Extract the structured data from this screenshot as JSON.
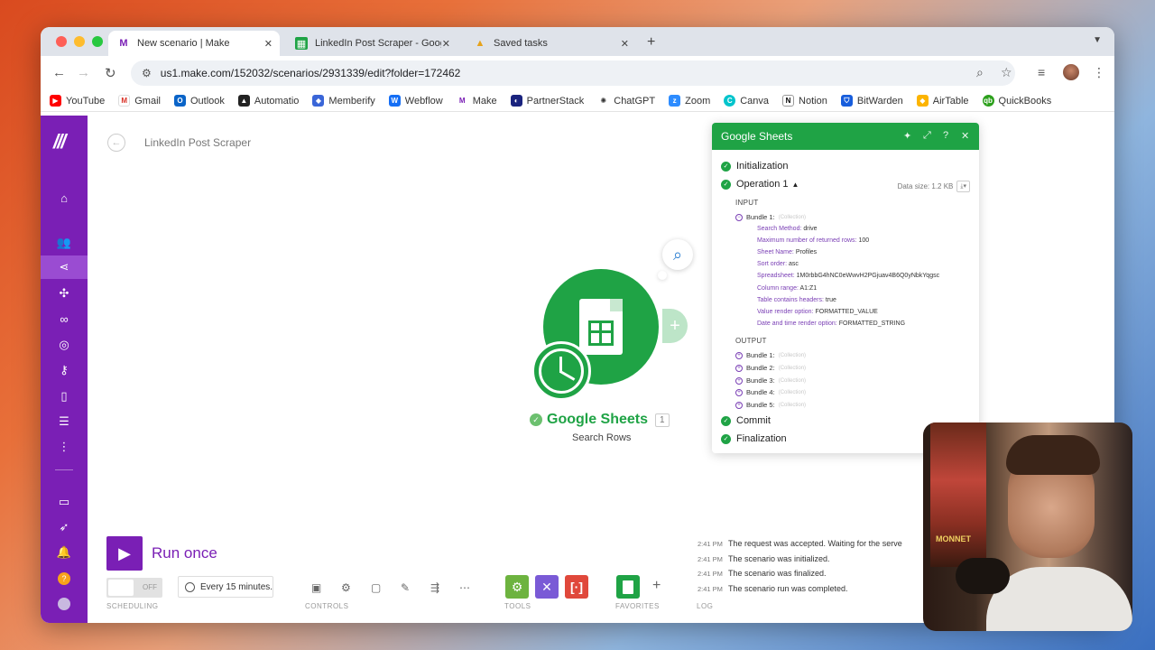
{
  "browser": {
    "tabs": [
      {
        "label": "New scenario | Make",
        "active": true
      },
      {
        "label": "LinkedIn Post Scraper - Goog",
        "active": false
      },
      {
        "label": "Saved tasks",
        "active": false
      }
    ],
    "url": "us1.make.com/152032/scenarios/2931339/edit?folder=172462",
    "bookmarks": [
      "YouTube",
      "Gmail",
      "Outlook",
      "Automatio",
      "Memberify",
      "Webflow",
      "Make",
      "PartnerStack",
      "ChatGPT",
      "Zoom",
      "Canva",
      "Notion",
      "BitWarden",
      "AirTable",
      "QuickBooks"
    ]
  },
  "scenario": {
    "name": "LinkedIn Post Scraper"
  },
  "module": {
    "title": "Google Sheets",
    "badge": "1",
    "subtitle": "Search Rows"
  },
  "panel": {
    "title": "Google Sheets",
    "initialization": "Initialization",
    "operation": "Operation 1",
    "data_size": "Data size: 1.2 KB",
    "input_label": "INPUT",
    "output_label": "OUTPUT",
    "collection_note": "(Collection)",
    "input_bundle": "Bundle 1:",
    "input_fields": [
      {
        "key": "Search Method:",
        "value": "drive"
      },
      {
        "key": "Maximum number of returned rows:",
        "value": "100"
      },
      {
        "key": "Sheet Name:",
        "value": "Profiles"
      },
      {
        "key": "Sort order:",
        "value": "asc"
      },
      {
        "key": "Spreadsheet:",
        "value": "1M0rbbG4hNC0eWwvH2PGjuav4B6Q0yNbkYqgsc"
      },
      {
        "key": "Column range:",
        "value": "A1:Z1"
      },
      {
        "key": "Table contains headers:",
        "value": "true"
      },
      {
        "key": "Value render option:",
        "value": "FORMATTED_VALUE"
      },
      {
        "key": "Date and time render option:",
        "value": "FORMATTED_STRING"
      }
    ],
    "output_bundles": [
      "Bundle 1:",
      "Bundle 2:",
      "Bundle 3:",
      "Bundle 4:",
      "Bundle 5:"
    ],
    "commit": "Commit",
    "finalization": "Finalization"
  },
  "controls": {
    "run_label": "Run once",
    "toggle_label": "OFF",
    "schedule": "Every 15 minutes.",
    "labels": {
      "scheduling": "SCHEDULING",
      "controls": "CONTROLS",
      "tools": "TOOLS",
      "favorites": "FAVORITES",
      "log": "LOG"
    }
  },
  "log": [
    {
      "time": "2:41 PM",
      "text": "The request was accepted. Waiting for the serve"
    },
    {
      "time": "2:41 PM",
      "text": "The scenario was initialized."
    },
    {
      "time": "2:41 PM",
      "text": "The scenario was finalized."
    },
    {
      "time": "2:41 PM",
      "text": "The scenario run was completed."
    }
  ],
  "webcam": {
    "poster_text": "MONNET"
  },
  "colors": {
    "make_purple": "#7a1fb5",
    "sheets_green": "#1fa345",
    "tools_green": "#6db33f",
    "tools_purple": "#7a5ad6",
    "tools_red": "#e0483b"
  }
}
